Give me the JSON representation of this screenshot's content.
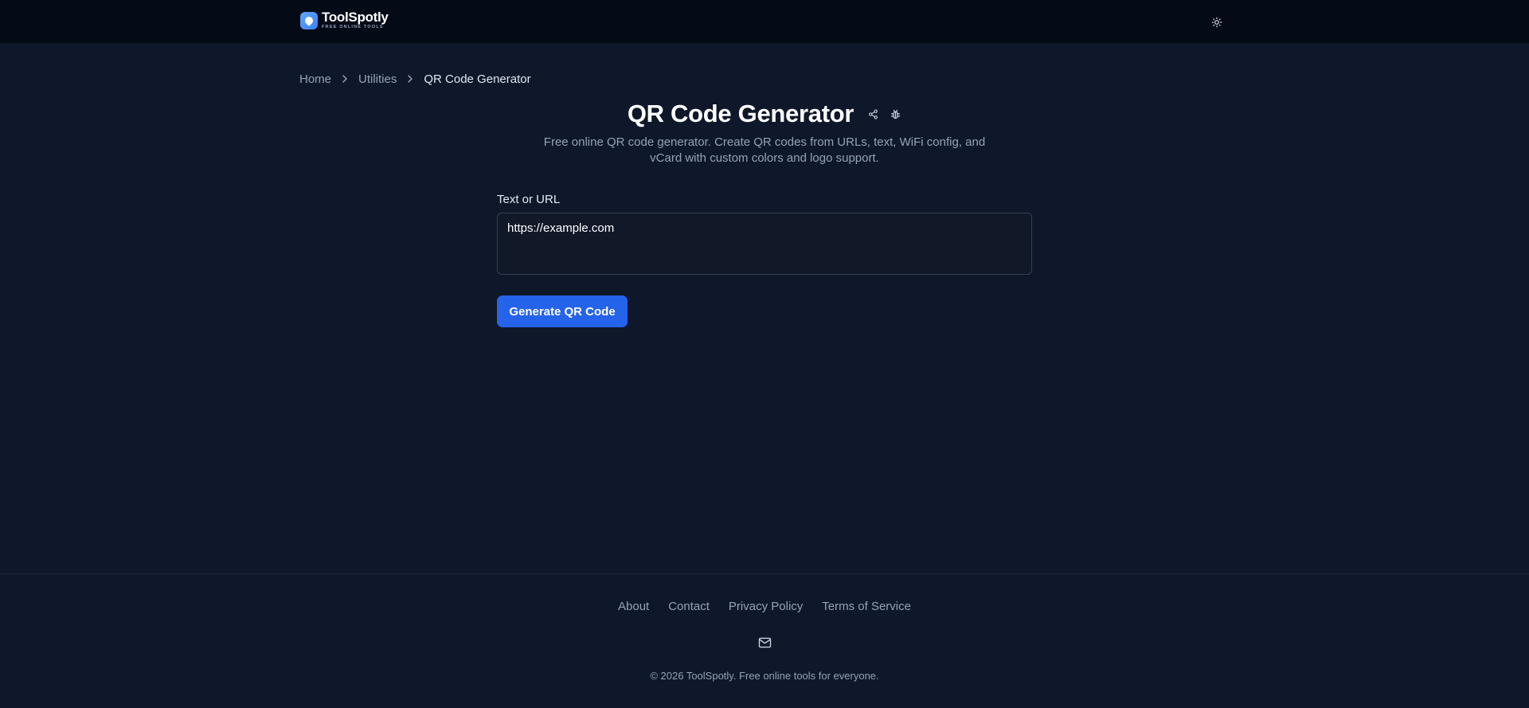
{
  "brand": {
    "name": "ToolSpotly",
    "tagline": "FREE ONLINE TOOLS"
  },
  "header": {
    "theme_toggle_icon": "sun-icon"
  },
  "breadcrumb": {
    "items": [
      {
        "label": "Home"
      },
      {
        "label": "Utilities"
      },
      {
        "label": "QR Code Generator"
      }
    ]
  },
  "page": {
    "title": "QR Code Generator",
    "share_icon": "share-icon",
    "report_icon": "bug-icon",
    "description_line1": "Free online QR code generator. Create QR codes from URLs, text, WiFi config, and",
    "description_line2": "vCard with custom colors and logo support."
  },
  "form": {
    "label": "Text or URL",
    "value": "https://example.com",
    "button_label": "Generate QR Code"
  },
  "footer": {
    "links": [
      "About",
      "Contact",
      "Privacy Policy",
      "Terms of Service"
    ],
    "mail_icon": "mail-icon",
    "copyright": "© 2026 ToolSpotly. Free online tools for everyone."
  },
  "colors": {
    "background": "#0f172a",
    "header_background": "#050b16",
    "accent": "#2563eb",
    "text_primary": "#ffffff",
    "text_muted": "#94a3b8"
  }
}
